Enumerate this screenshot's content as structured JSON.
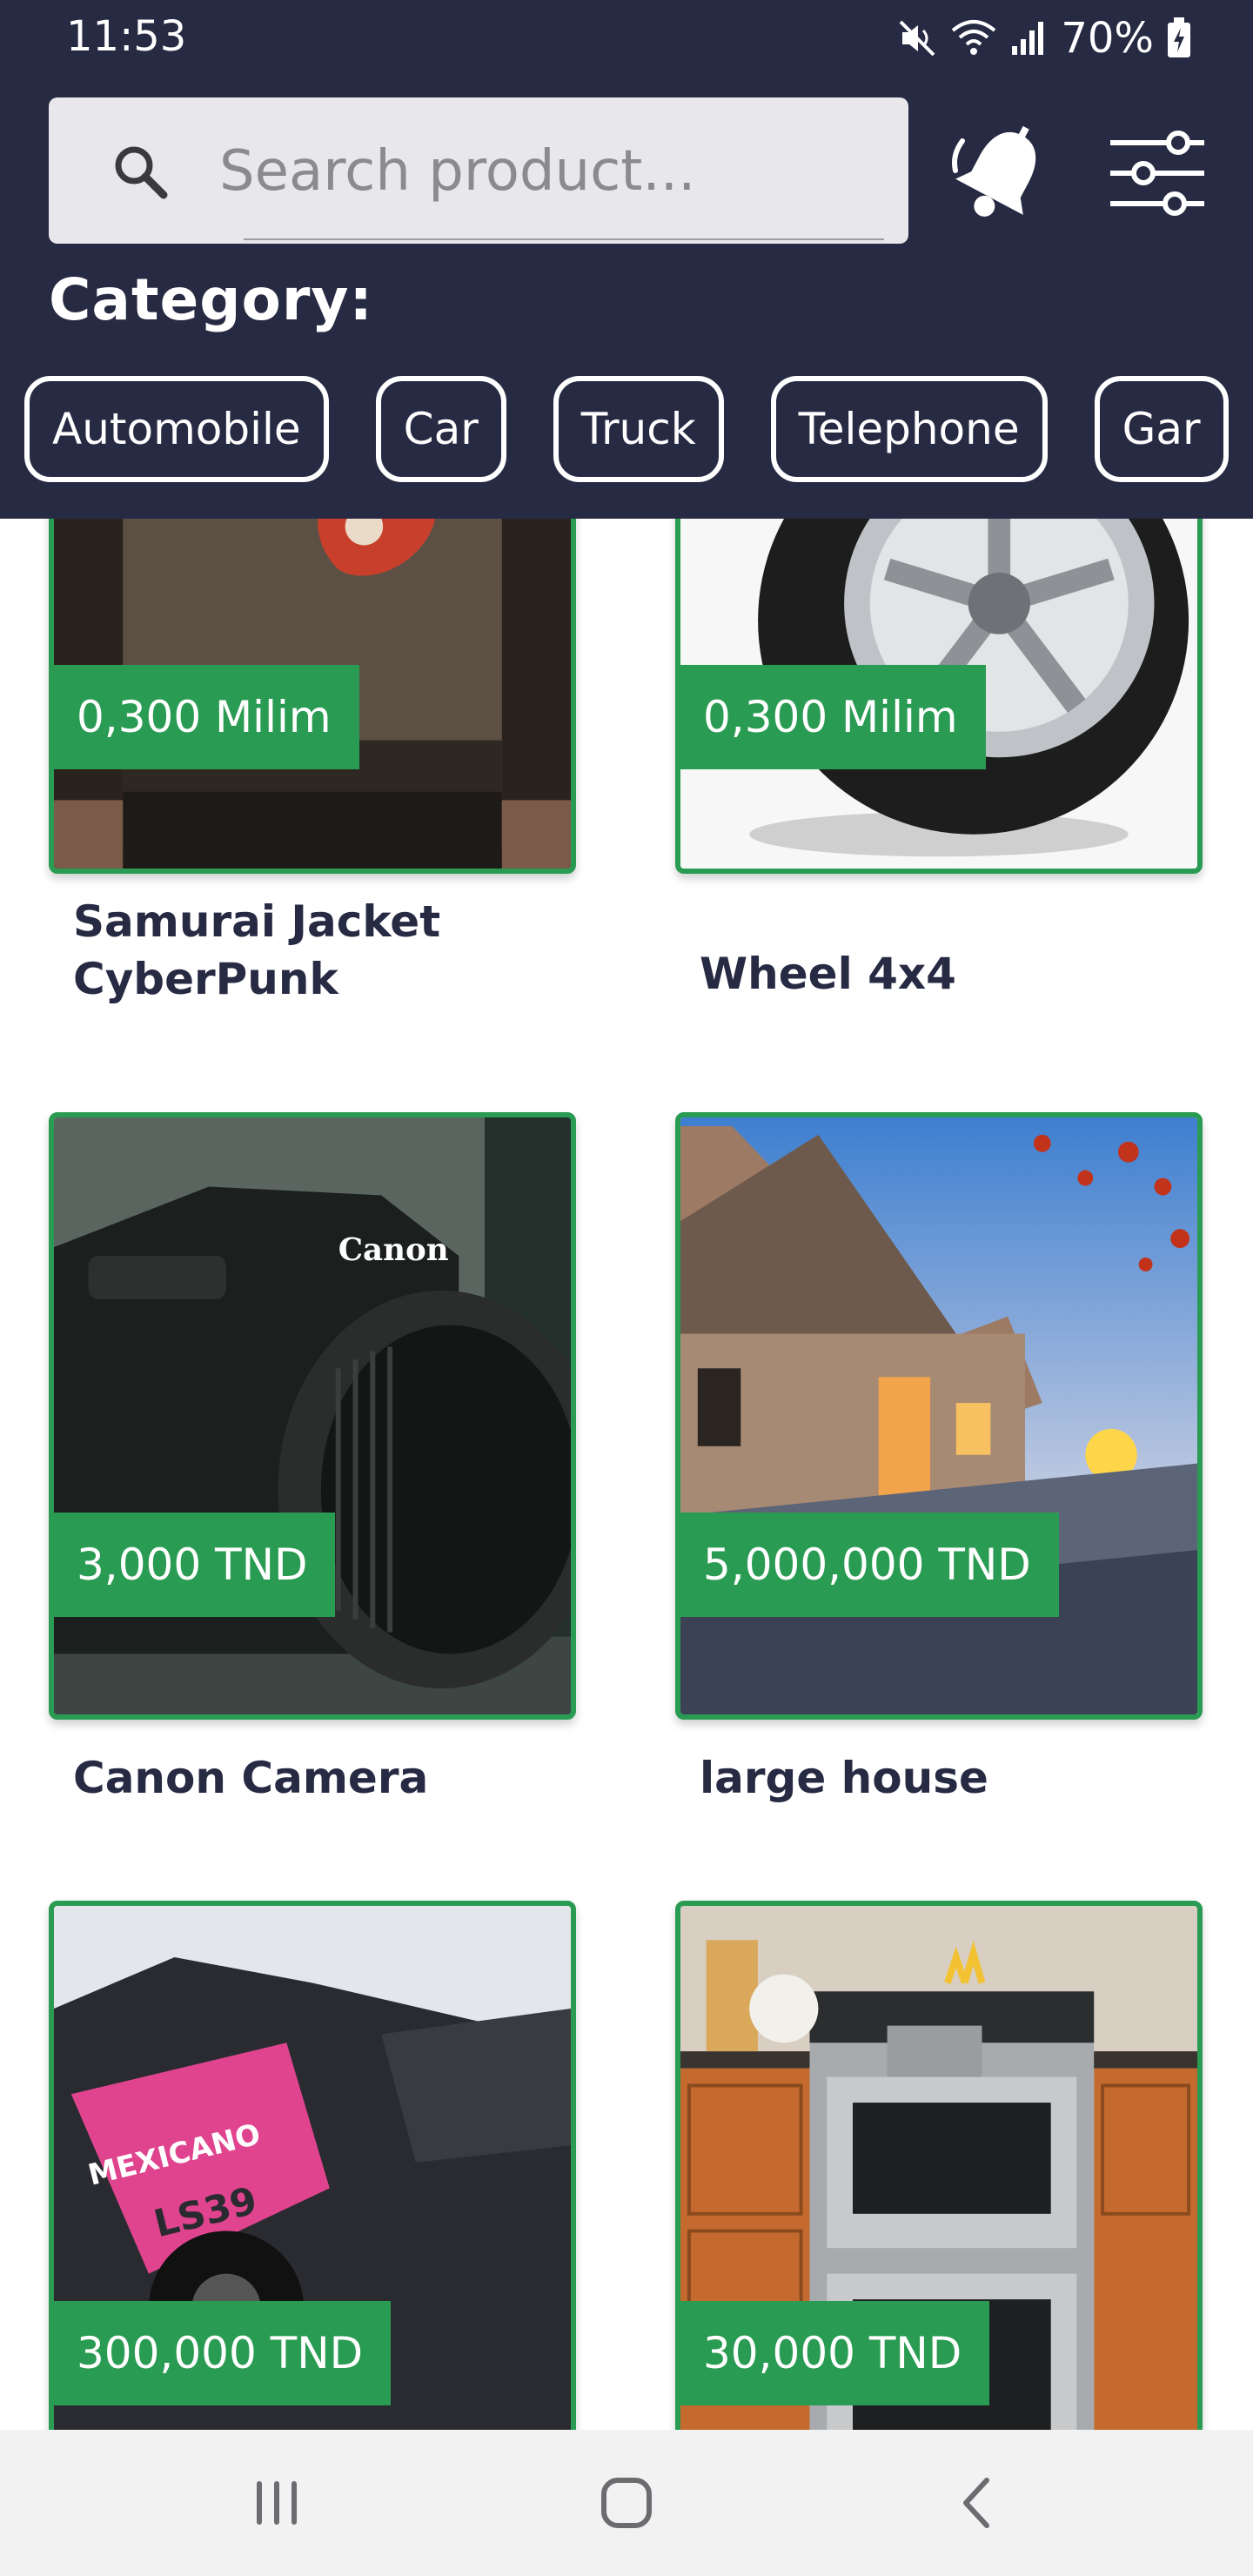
{
  "status_bar": {
    "time": "11:53",
    "battery": "70%",
    "icons": [
      "mute-icon",
      "wifi-icon",
      "signal-icon",
      "battery-icon"
    ]
  },
  "search": {
    "placeholder": "Search product...",
    "value": ""
  },
  "header": {
    "notification_icon": "bell-icon",
    "filter_icon": "sliders-icon",
    "category_label": "Category:"
  },
  "categories": [
    "Automobile",
    "Car",
    "Truck",
    "Telephone",
    "Gar"
  ],
  "products": [
    {
      "name": "Samurai Jacket CyberPunk",
      "price": "0,300 Milim"
    },
    {
      "name": "Wheel 4x4",
      "price": "0,300 Milim"
    },
    {
      "name": "Canon Camera",
      "price": "3,000 TND"
    },
    {
      "name": "large house",
      "price": "5,000,000 TND"
    },
    {
      "name": "",
      "price": "300,000 TND"
    },
    {
      "name": "",
      "price": "30,000 TND"
    }
  ],
  "navbar": {
    "buttons": [
      "recent-apps-icon",
      "home-icon",
      "back-icon"
    ]
  },
  "colors": {
    "header_bg": "#272a43",
    "accent_green": "#2a9b52",
    "text_dark": "#272a43",
    "navbar_bg": "#f2f2f2"
  }
}
